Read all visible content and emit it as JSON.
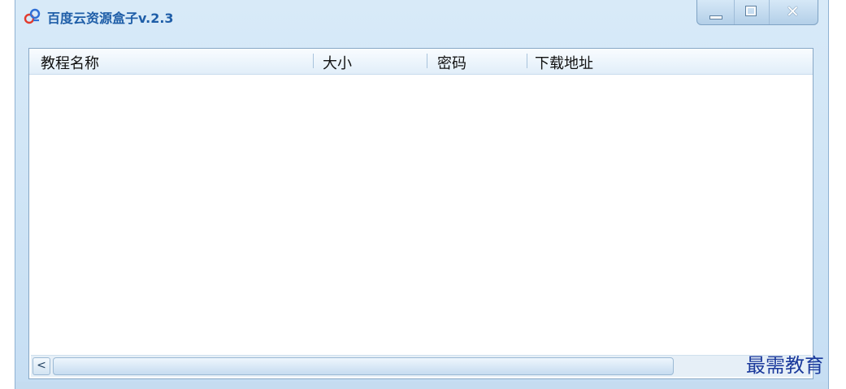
{
  "window": {
    "title": "百度云资源盒子v.2.3"
  },
  "icons": {
    "app": "baidu-cloud-icon",
    "minimize": "minimize-icon",
    "maximize": "maximize-icon",
    "close": "close-icon",
    "scroll_left": "chevron-left-icon"
  },
  "list": {
    "columns": [
      "教程名称",
      "大小",
      "密码",
      "下载地址"
    ],
    "rows": []
  },
  "scrollbar": {
    "left_glyph": "<"
  },
  "watermark": {
    "text": "最需教育"
  },
  "colors": {
    "title": "#1f5ea8",
    "accent": "#88a8c6",
    "watermark": "#1b3a9c"
  }
}
